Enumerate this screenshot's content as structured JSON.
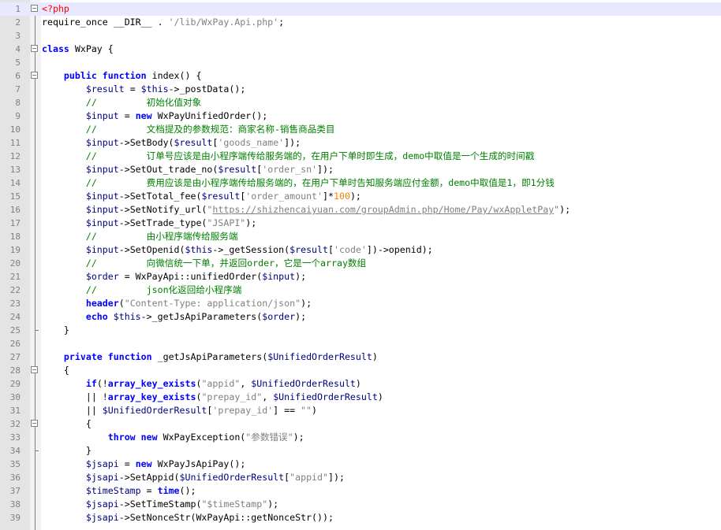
{
  "editor": {
    "language": "php",
    "current_line": 1,
    "colors": {
      "gutter_bg": "#e4e4e4",
      "current_line_bg": "#e8e8ff",
      "keyword": "#0000ff",
      "variable": "#000080",
      "string": "#808080",
      "comment": "#008000",
      "php_tag": "#ff0000",
      "number": "#ff8000"
    },
    "lines": [
      {
        "n": "1",
        "fold": "open",
        "tokens": [
          [
            "tag",
            "<?php"
          ]
        ]
      },
      {
        "n": "2",
        "tokens": [
          [
            "",
            "require_once __DIR__ . "
          ],
          [
            "str",
            "'/lib/WxPay.Api.php'"
          ],
          [
            "",
            ";"
          ]
        ]
      },
      {
        "n": "3",
        "tokens": []
      },
      {
        "n": "4",
        "fold": "open",
        "tokens": [
          [
            "kw",
            "class"
          ],
          [
            "",
            " WxPay {"
          ]
        ]
      },
      {
        "n": "5",
        "tokens": []
      },
      {
        "n": "6",
        "fold": "open",
        "tokens": [
          [
            "",
            "    "
          ],
          [
            "kw",
            "public"
          ],
          [
            "",
            " "
          ],
          [
            "kw",
            "function"
          ],
          [
            "",
            " index() {"
          ]
        ]
      },
      {
        "n": "7",
        "tokens": [
          [
            "",
            "        "
          ],
          [
            "var",
            "$result"
          ],
          [
            "",
            " = "
          ],
          [
            "var",
            "$this"
          ],
          [
            "",
            "->_postData();"
          ]
        ]
      },
      {
        "n": "8",
        "tokens": [
          [
            "",
            "        "
          ],
          [
            "cmt",
            "//         初始化值对象"
          ]
        ]
      },
      {
        "n": "9",
        "tokens": [
          [
            "",
            "        "
          ],
          [
            "var",
            "$input"
          ],
          [
            "",
            " = "
          ],
          [
            "kw",
            "new"
          ],
          [
            "",
            " WxPayUnifiedOrder();"
          ]
        ]
      },
      {
        "n": "10",
        "tokens": [
          [
            "",
            "        "
          ],
          [
            "cmt",
            "//         文档提及的参数规范：商家名称-销售商品类目"
          ]
        ]
      },
      {
        "n": "11",
        "tokens": [
          [
            "",
            "        "
          ],
          [
            "var",
            "$input"
          ],
          [
            "",
            "->SetBody("
          ],
          [
            "var",
            "$result"
          ],
          [
            "",
            "["
          ],
          [
            "str",
            "'goods_name'"
          ],
          [
            "",
            "]);"
          ]
        ]
      },
      {
        "n": "12",
        "tokens": [
          [
            "",
            "        "
          ],
          [
            "cmt",
            "//         订单号应该是由小程序端传给服务端的，在用户下单时即生成，demo中取值是一个生成的时间戳"
          ]
        ]
      },
      {
        "n": "13",
        "tokens": [
          [
            "",
            "        "
          ],
          [
            "var",
            "$input"
          ],
          [
            "",
            "->SetOut_trade_no("
          ],
          [
            "var",
            "$result"
          ],
          [
            "",
            "["
          ],
          [
            "str",
            "'order_sn'"
          ],
          [
            "",
            "]);"
          ]
        ]
      },
      {
        "n": "14",
        "tokens": [
          [
            "",
            "        "
          ],
          [
            "cmt",
            "//         费用应该是由小程序端传给服务端的，在用户下单时告知服务端应付金额，demo中取值是1，即1分钱"
          ]
        ]
      },
      {
        "n": "15",
        "tokens": [
          [
            "",
            "        "
          ],
          [
            "var",
            "$input"
          ],
          [
            "",
            "->SetTotal_fee("
          ],
          [
            "var",
            "$result"
          ],
          [
            "",
            "["
          ],
          [
            "str",
            "'order_amount'"
          ],
          [
            "",
            "]*"
          ],
          [
            "num",
            "100"
          ],
          [
            "",
            ");"
          ]
        ]
      },
      {
        "n": "16",
        "tokens": [
          [
            "",
            "        "
          ],
          [
            "var",
            "$input"
          ],
          [
            "",
            "->SetNotify_url("
          ],
          [
            "str",
            "\""
          ],
          [
            "url",
            "https://shizhencaiyuan.com/groupAdmin.php/Home/Pay/wxAppletPay"
          ],
          [
            "str",
            "\""
          ],
          [
            "",
            ");"
          ]
        ]
      },
      {
        "n": "17",
        "tokens": [
          [
            "",
            "        "
          ],
          [
            "var",
            "$input"
          ],
          [
            "",
            "->SetTrade_type("
          ],
          [
            "str",
            "\"JSAPI\""
          ],
          [
            "",
            ");"
          ]
        ]
      },
      {
        "n": "18",
        "tokens": [
          [
            "",
            "        "
          ],
          [
            "cmt",
            "//         由小程序端传给服务端"
          ]
        ]
      },
      {
        "n": "19",
        "tokens": [
          [
            "",
            "        "
          ],
          [
            "var",
            "$input"
          ],
          [
            "",
            "->SetOpenid("
          ],
          [
            "var",
            "$this"
          ],
          [
            "",
            "->_getSession("
          ],
          [
            "var",
            "$result"
          ],
          [
            "",
            "["
          ],
          [
            "str",
            "'code'"
          ],
          [
            "",
            "])->openid);"
          ]
        ]
      },
      {
        "n": "20",
        "tokens": [
          [
            "",
            "        "
          ],
          [
            "cmt",
            "//         向微信统一下单，并返回order，它是一个array数组"
          ]
        ]
      },
      {
        "n": "21",
        "tokens": [
          [
            "",
            "        "
          ],
          [
            "var",
            "$order"
          ],
          [
            "",
            " = WxPayApi::unifiedOrder("
          ],
          [
            "var",
            "$input"
          ],
          [
            "",
            ");"
          ]
        ]
      },
      {
        "n": "22",
        "tokens": [
          [
            "",
            "        "
          ],
          [
            "cmt",
            "//         json化返回给小程序端"
          ]
        ]
      },
      {
        "n": "23",
        "tokens": [
          [
            "",
            "        "
          ],
          [
            "kw",
            "header"
          ],
          [
            "",
            "("
          ],
          [
            "str",
            "\"Content-Type: application/json\""
          ],
          [
            "",
            ");"
          ]
        ]
      },
      {
        "n": "24",
        "tokens": [
          [
            "",
            "        "
          ],
          [
            "kw",
            "echo"
          ],
          [
            "",
            " "
          ],
          [
            "var",
            "$this"
          ],
          [
            "",
            "->_getJsApiParameters("
          ],
          [
            "var",
            "$order"
          ],
          [
            "",
            ");"
          ]
        ]
      },
      {
        "n": "25",
        "fold": "end",
        "tokens": [
          [
            "",
            "    }"
          ]
        ]
      },
      {
        "n": "26",
        "tokens": []
      },
      {
        "n": "27",
        "tokens": [
          [
            "",
            "    "
          ],
          [
            "kw",
            "private"
          ],
          [
            "",
            " "
          ],
          [
            "kw",
            "function"
          ],
          [
            "",
            " _getJsApiParameters("
          ],
          [
            "var",
            "$UnifiedOrderResult"
          ],
          [
            "",
            ")"
          ]
        ]
      },
      {
        "n": "28",
        "fold": "open",
        "tokens": [
          [
            "",
            "    {"
          ]
        ]
      },
      {
        "n": "29",
        "tokens": [
          [
            "",
            "        "
          ],
          [
            "kw",
            "if"
          ],
          [
            "",
            "(!"
          ],
          [
            "kw",
            "array_key_exists"
          ],
          [
            "",
            "("
          ],
          [
            "str",
            "\"appid\""
          ],
          [
            "",
            ", "
          ],
          [
            "var",
            "$UnifiedOrderResult"
          ],
          [
            "",
            ")"
          ]
        ]
      },
      {
        "n": "30",
        "tokens": [
          [
            "",
            "        || !"
          ],
          [
            "kw",
            "array_key_exists"
          ],
          [
            "",
            "("
          ],
          [
            "str",
            "\"prepay_id\""
          ],
          [
            "",
            ", "
          ],
          [
            "var",
            "$UnifiedOrderResult"
          ],
          [
            "",
            ")"
          ]
        ]
      },
      {
        "n": "31",
        "tokens": [
          [
            "",
            "        || "
          ],
          [
            "var",
            "$UnifiedOrderResult"
          ],
          [
            "",
            "["
          ],
          [
            "str",
            "'prepay_id'"
          ],
          [
            "",
            "] == "
          ],
          [
            "str",
            "\"\""
          ],
          [
            "",
            ")"
          ]
        ]
      },
      {
        "n": "32",
        "fold": "open",
        "tokens": [
          [
            "",
            "        {"
          ]
        ]
      },
      {
        "n": "33",
        "tokens": [
          [
            "",
            "            "
          ],
          [
            "kw",
            "throw"
          ],
          [
            "",
            " "
          ],
          [
            "kw",
            "new"
          ],
          [
            "",
            " WxPayException("
          ],
          [
            "str",
            "\"参数错误\""
          ],
          [
            "",
            ");"
          ]
        ]
      },
      {
        "n": "34",
        "fold": "end",
        "tokens": [
          [
            "",
            "        }"
          ]
        ]
      },
      {
        "n": "35",
        "tokens": [
          [
            "",
            "        "
          ],
          [
            "var",
            "$jsapi"
          ],
          [
            "",
            " = "
          ],
          [
            "kw",
            "new"
          ],
          [
            "",
            " WxPayJsApiPay();"
          ]
        ]
      },
      {
        "n": "36",
        "tokens": [
          [
            "",
            "        "
          ],
          [
            "var",
            "$jsapi"
          ],
          [
            "",
            "->SetAppid("
          ],
          [
            "var",
            "$UnifiedOrderResult"
          ],
          [
            "",
            "["
          ],
          [
            "str",
            "\"appid\""
          ],
          [
            "",
            "]);"
          ]
        ]
      },
      {
        "n": "37",
        "tokens": [
          [
            "",
            "        "
          ],
          [
            "var",
            "$timeStamp"
          ],
          [
            "",
            " = "
          ],
          [
            "kw",
            "time"
          ],
          [
            "",
            "();"
          ]
        ]
      },
      {
        "n": "38",
        "tokens": [
          [
            "",
            "        "
          ],
          [
            "var",
            "$jsapi"
          ],
          [
            "",
            "->SetTimeStamp("
          ],
          [
            "str",
            "\"$timeStamp\""
          ],
          [
            "",
            ");"
          ]
        ]
      },
      {
        "n": "39",
        "tokens": [
          [
            "",
            "        "
          ],
          [
            "var",
            "$jsapi"
          ],
          [
            "",
            "->SetNonceStr(WxPayApi::getNonceStr());"
          ]
        ]
      }
    ]
  }
}
